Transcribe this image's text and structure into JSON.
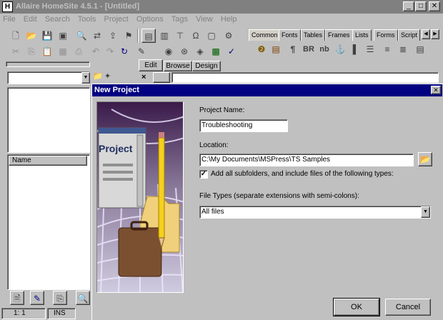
{
  "window": {
    "title": "Allaire HomeSite 4.5.1 - [Untitled]",
    "controls": [
      "_",
      "□",
      "✕"
    ]
  },
  "menu": [
    "File",
    "Edit",
    "Search",
    "Tools",
    "Project",
    "Options",
    "Tags",
    "View",
    "Help"
  ],
  "tag_tabs": [
    "Common",
    "Fonts",
    "Tables",
    "Frames",
    "Lists",
    "Forms",
    "Script"
  ],
  "tag_toolbar_labels": {
    "paragraph": "¶",
    "br": "BR",
    "nbsp": "nb",
    "anchor": "⚓"
  },
  "editor_tabs": [
    "Edit",
    "Browse",
    "Design"
  ],
  "editor_close": "×",
  "left_panel": {
    "list_header": "Name"
  },
  "status": {
    "position": "1: 1",
    "mode": "INS"
  },
  "dialog": {
    "title": "New Project",
    "close": "✕",
    "illustration_text": "Project",
    "project_name_label": "Project Name:",
    "project_name_value": "Troubleshooting",
    "location_label": "Location:",
    "location_value": "C:\\My Documents\\MSPress\\TS Samples",
    "subfolders_label": "Add all subfolders, and include files of the following types:",
    "subfolders_checked": "✓",
    "file_types_label": "File Types (separate extensions with semi-colons):",
    "file_types_value": "All files",
    "ok": "OK",
    "cancel": "Cancel"
  }
}
